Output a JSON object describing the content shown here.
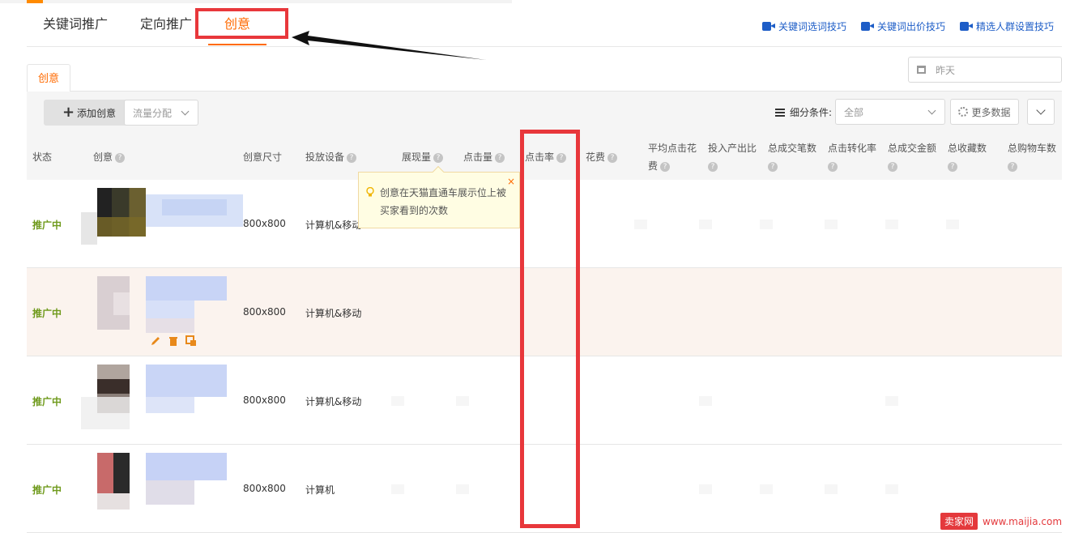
{
  "top_tabs": [
    {
      "label": "关键词推广"
    },
    {
      "label": "定向推广"
    },
    {
      "label": "创意"
    }
  ],
  "tips": [
    {
      "label": "关键词选词技巧",
      "icon": "video-icon"
    },
    {
      "label": "关键词出价技巧",
      "icon": "video-icon"
    },
    {
      "label": "精选人群设置技巧",
      "icon": "video-icon"
    }
  ],
  "sub_tab": "创意",
  "date_filter": {
    "value": "昨天",
    "icon": "calendar-icon"
  },
  "toolbar": {
    "add_label": "添加创意",
    "flow_dropdown": "流量分配",
    "segment_label": "细分条件:",
    "segment_value": "全部",
    "more_label": "更多数据"
  },
  "columns": {
    "status": "状态",
    "creative": "创意",
    "size": "创意尺寸",
    "device": "投放设备",
    "impressions": "展现量",
    "clicks": "点击量",
    "ctr": "点击率",
    "cost": "花费",
    "avg_cpc_line1": "平均点击花",
    "avg_cpc_line2": "费",
    "roi": "投入产出比",
    "orders": "总成交笔数",
    "cvr": "点击转化率",
    "gmv": "总成交金额",
    "favs": "总收藏数",
    "carts": "总购物车数"
  },
  "rows": [
    {
      "status": "推广中",
      "size": "800x800",
      "device": "计算机&移动"
    },
    {
      "status": "推广中",
      "size": "800x800",
      "device": "计算机&移动"
    },
    {
      "status": "推广中",
      "size": "800x800",
      "device": "计算机&移动"
    },
    {
      "status": "推广中",
      "size": "800x800",
      "device": "计算机"
    }
  ],
  "tooltip": {
    "line1": "创意在天猫直通车展示位上被",
    "line2": "买家看到的次数"
  },
  "watermark": {
    "badge": "卖家网",
    "url": "www.maijia.com"
  },
  "colors": {
    "accent": "#ff6a00",
    "link": "#1d5dc7",
    "status": "#6f9a1c",
    "annotation": "#e8373b"
  }
}
